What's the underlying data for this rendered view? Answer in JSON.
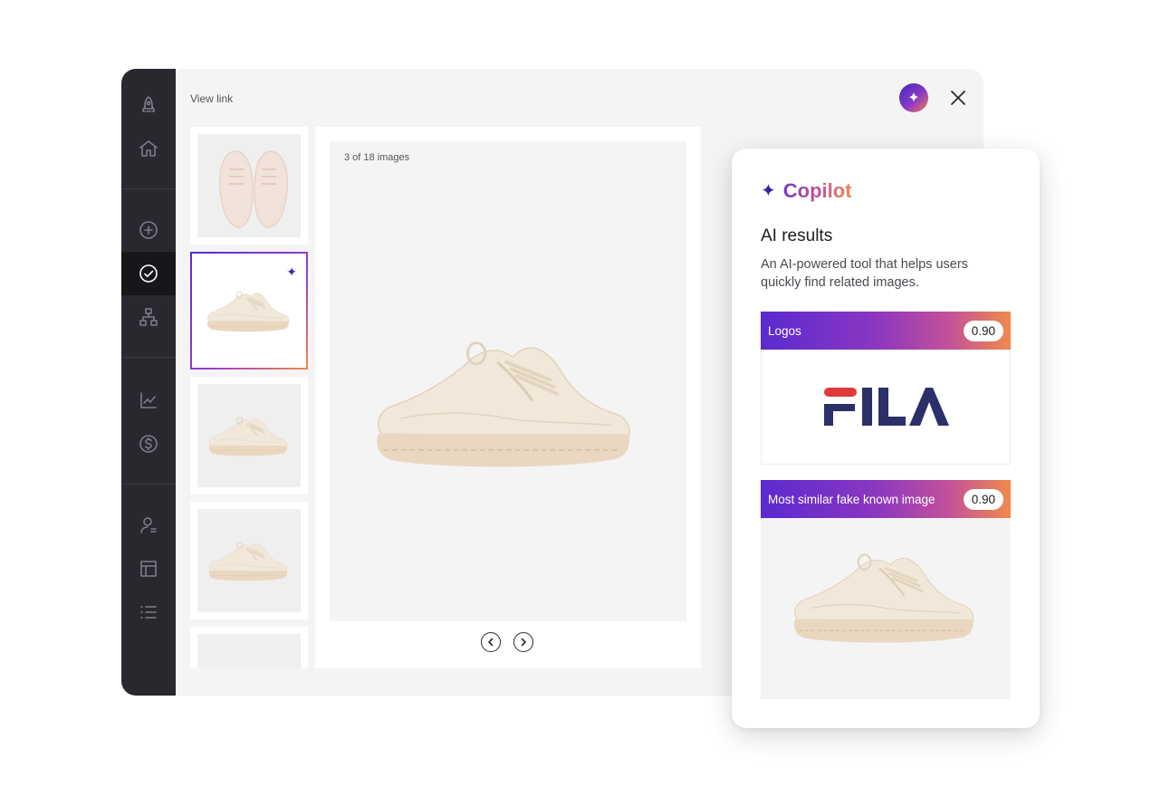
{
  "app": {
    "view_link": "View link",
    "sidebar": {
      "items": [
        {
          "name": "rocket",
          "active": false
        },
        {
          "name": "home",
          "active": false
        },
        {
          "name": "add",
          "active": false
        },
        {
          "name": "check",
          "active": true
        },
        {
          "name": "hierarchy",
          "active": false
        },
        {
          "name": "chart",
          "active": false
        },
        {
          "name": "dollar",
          "active": false
        },
        {
          "name": "user",
          "active": false
        },
        {
          "name": "layout",
          "active": false
        },
        {
          "name": "list",
          "active": false
        }
      ]
    }
  },
  "viewer": {
    "counter": "3 of 18 images"
  },
  "copilot": {
    "brand": "Copilot",
    "title": "AI results",
    "description": "An AI-powered tool that helps users quickly find related images.",
    "cards": [
      {
        "label": "Logos",
        "score": "0.90",
        "logo_text": "FILA"
      },
      {
        "label": "Most similar fake known image",
        "score": "0.90"
      }
    ]
  },
  "colors": {
    "sidebar": "#28282f",
    "accent_start": "#5a2ad0",
    "accent_end": "#f08a4b",
    "fila_red": "#e0393a",
    "fila_navy": "#2c3068"
  }
}
